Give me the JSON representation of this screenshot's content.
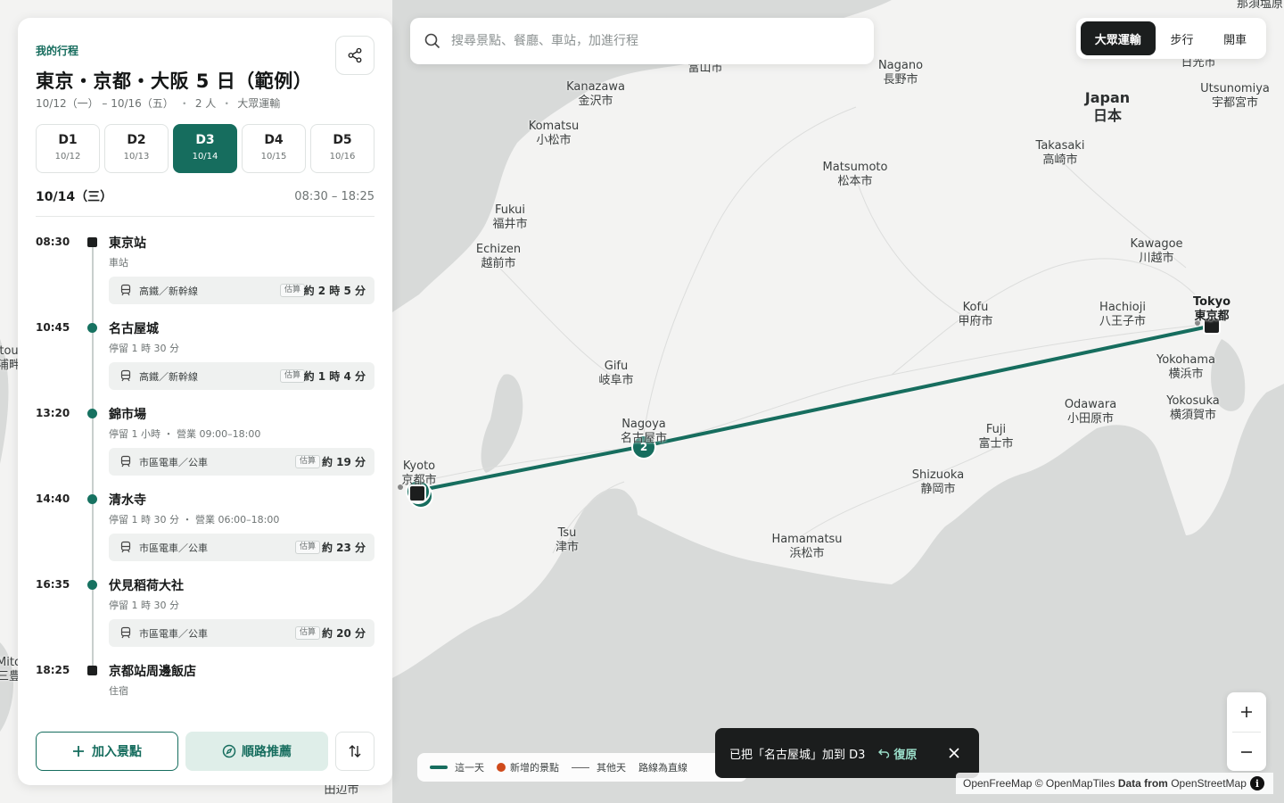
{
  "search": {
    "placeholder": "搜尋景點、餐廳、車站，加進行程"
  },
  "modes": [
    {
      "label": "大眾運輸",
      "active": true
    },
    {
      "label": "步行",
      "active": false
    },
    {
      "label": "開車",
      "active": false
    }
  ],
  "panel": {
    "eyebrow": "我的行程",
    "title": "東京・京都・大阪 5 日（範例）",
    "meta": {
      "dates": "10/12（一） – 10/16（五）",
      "people": "2 人",
      "transport": "大眾運輸"
    },
    "meta_sep": "・",
    "days": [
      {
        "label": "D1",
        "date": "10/12",
        "active": false
      },
      {
        "label": "D2",
        "date": "10/13",
        "active": false
      },
      {
        "label": "D3",
        "date": "10/14",
        "active": true
      },
      {
        "label": "D4",
        "date": "10/15",
        "active": false
      },
      {
        "label": "D5",
        "date": "10/16",
        "active": false
      }
    ],
    "selected_date": "10/14（三）",
    "time_range": "08:30 – 18:25",
    "stops": [
      {
        "time": "08:30",
        "name": "東京站",
        "sub": "車站",
        "marker": "square",
        "transit": {
          "mode": "高鐵／新幹線",
          "est": "估算",
          "duration": "約 2 時 5 分"
        }
      },
      {
        "time": "10:45",
        "name": "名古屋城",
        "sub": "停留 1 時 30 分",
        "marker": "dot",
        "transit": {
          "mode": "高鐵／新幹線",
          "est": "估算",
          "duration": "約 1 時 4 分"
        }
      },
      {
        "time": "13:20",
        "name": "錦市場",
        "sub": "停留 1 小時 ・ 營業 09:00–18:00",
        "marker": "dot",
        "transit": {
          "mode": "市區電車／公車",
          "est": "估算",
          "duration": "約 19 分"
        }
      },
      {
        "time": "14:40",
        "name": "清水寺",
        "sub": "停留 1 時 30 分 ・ 營業 06:00–18:00",
        "marker": "dot",
        "transit": {
          "mode": "市區電車／公車",
          "est": "估算",
          "duration": "約 23 分"
        }
      },
      {
        "time": "16:35",
        "name": "伏見稻荷大社",
        "sub": "停留 1 時 30 分",
        "marker": "dot",
        "transit": {
          "mode": "市區電車／公車",
          "est": "估算",
          "duration": "約 20 分"
        }
      },
      {
        "time": "18:25",
        "name": "京都站周邊飯店",
        "sub": "住宿",
        "marker": "square",
        "transit": null
      }
    ],
    "add_label": "加入景點",
    "optimize_label": "順路推薦"
  },
  "map": {
    "route_color": "#166d5e",
    "marker_number": "2",
    "labels": [
      {
        "text": "富山市"
      },
      {
        "text": "Nagano\n長野市"
      },
      {
        "text": "日光市"
      },
      {
        "text": "Utsunomiya\n宇都宮市"
      },
      {
        "text": "Japan\n日本",
        "country": true
      },
      {
        "text": "Kanazawa\n金沢市"
      },
      {
        "text": "Komatsu\n小松市"
      },
      {
        "text": "Takasaki\n高崎市"
      },
      {
        "text": "Matsumoto\n松本市"
      },
      {
        "text": "Fukui\n福井市"
      },
      {
        "text": "Echizen\n越前市"
      },
      {
        "text": "Kawagoe\n川越市"
      },
      {
        "text": "Kofu\n甲府市"
      },
      {
        "text": "Hachioji\n八王子市"
      },
      {
        "text": "Tokyo\n東京都",
        "tokyo": true
      },
      {
        "text": "Gifu\n岐阜市"
      },
      {
        "text": "Yokohama\n横浜市"
      },
      {
        "text": "Odawara\n小田原市"
      },
      {
        "text": "Yokosuka\n横須賀市"
      },
      {
        "text": "Nagoya\n名古屋市"
      },
      {
        "text": "Fuji\n富士市"
      },
      {
        "text": "Kyoto\n京都市"
      },
      {
        "text": "Shizuoka\n静岡市"
      },
      {
        "text": "Tsu\n津市"
      },
      {
        "text": "Hamamatsu\n浜松市"
      },
      {
        "text": "田辺市"
      },
      {
        "text": "那須塩原"
      },
      {
        "text": "tou\n浦畔"
      },
      {
        "text": "Mito\n三豊"
      }
    ]
  },
  "legend": {
    "this_day": "這一天",
    "new_spot": "新增的景點",
    "other_days": "其他天",
    "straight": "路線為直線"
  },
  "toast": {
    "message": "已把「名古屋城」加到 D3",
    "undo": "復原"
  },
  "attribution": {
    "osm": "OpenFreeMap",
    "tiles": "© OpenMapTiles",
    "data_from": "Data from",
    "source": "OpenStreetMap",
    "info": "i"
  }
}
